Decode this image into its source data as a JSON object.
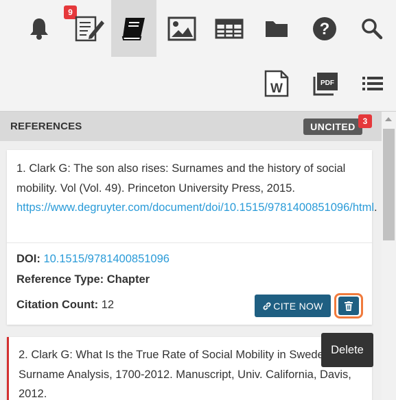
{
  "toolbar": {
    "notification_count": "9",
    "buttons": [
      "bell-icon",
      "edit-document-icon",
      "book-icon",
      "image-icon",
      "table-icon",
      "folder-icon",
      "help-icon",
      "search-icon"
    ],
    "active": "book-icon"
  },
  "toolbar2": {
    "buttons": [
      "word-export-icon",
      "pdf-export-icon",
      "list-icon"
    ]
  },
  "references": {
    "title": "REFERENCES",
    "uncited_label": "UNCITED",
    "uncited_count": "3"
  },
  "items": [
    {
      "text": "1. Clark G: The son also rises: Surnames and the history of social mobility. Vol (Vol. 49). Princeton University Press, 2015. ",
      "link": "https://www.degruyter.com/document/doi/10.1515/9781400851096/html",
      "after_link": ".",
      "doi_label": "DOI:",
      "doi": "10.1515/9781400851096",
      "type_label": "Reference Type:",
      "type": "Chapter",
      "count_label": "Citation Count:",
      "count": "12",
      "cite_label": "CITE NOW"
    },
    {
      "text": "2. Clark G: What Is the True Rate of Social Mobility in Sweden? A Surname Analysis, 1700-2012. Manuscript, Univ. California, Davis, 2012."
    }
  ],
  "tooltip": "Delete",
  "colors": {
    "accent": "#1f5f82",
    "link": "#2a9bd8",
    "badge": "#e5383b",
    "highlight": "#f07a3c"
  }
}
